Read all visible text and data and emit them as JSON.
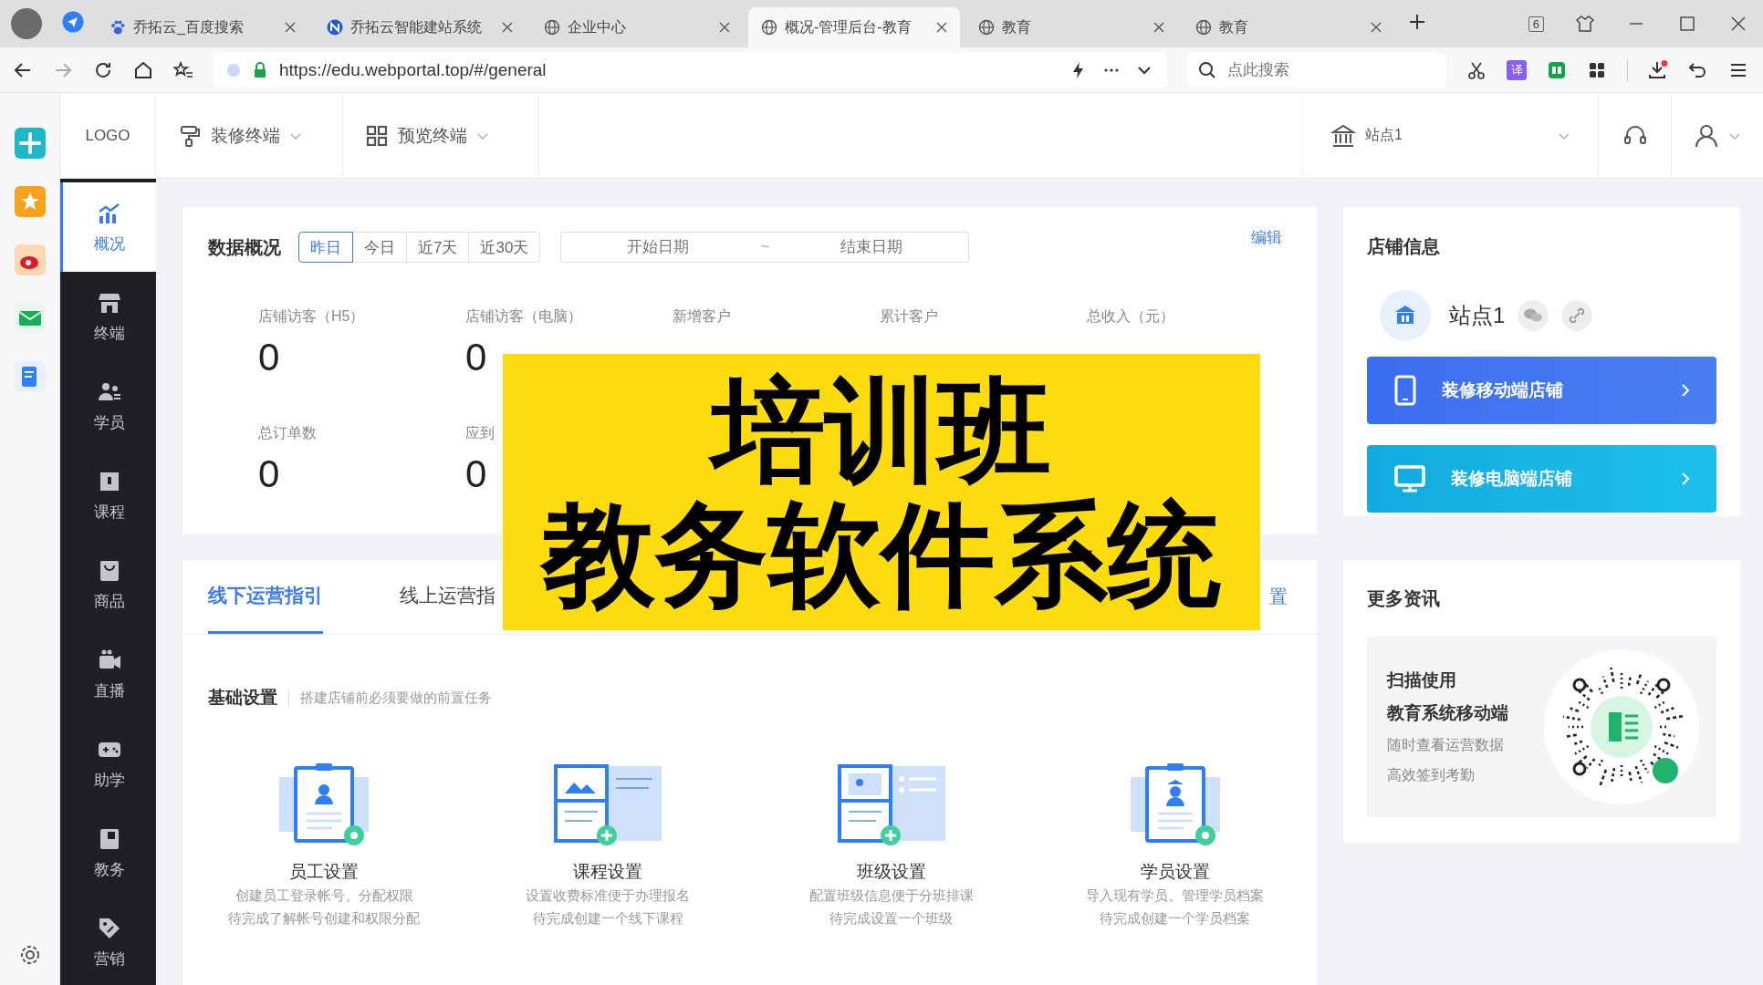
{
  "browser": {
    "tabs": [
      {
        "label": "乔拓云_百度搜索",
        "kind": "paw",
        "selected": false
      },
      {
        "label": "乔拓云智能建站系统",
        "kind": "circle",
        "selected": false
      },
      {
        "label": "企业中心",
        "kind": "globe",
        "selected": false
      },
      {
        "label": "概况-管理后台-教育",
        "kind": "globe",
        "selected": true
      },
      {
        "label": "教育",
        "kind": "globe",
        "selected": false
      },
      {
        "label": "教育",
        "kind": "globe",
        "selected": false
      }
    ],
    "tab_count": "6",
    "address": "https://edu.webportal.top/#/general",
    "search": {
      "placeholder": "点此搜索"
    },
    "translate_glyph": "译"
  },
  "app_header": {
    "logo": "LOGO",
    "menus": [
      {
        "label": "装修终端",
        "kind": "brush"
      },
      {
        "label": "预览终端",
        "kind": "grid"
      }
    ],
    "site": "站点1"
  },
  "sidebar": {
    "items": [
      {
        "label": "概况",
        "kind": "chart",
        "selected": true
      },
      {
        "label": "终端",
        "kind": "store",
        "selected": false
      },
      {
        "label": "学员",
        "kind": "people",
        "selected": false
      },
      {
        "label": "课程",
        "kind": "book",
        "selected": false
      },
      {
        "label": "商品",
        "kind": "bag",
        "selected": false
      },
      {
        "label": "直播",
        "kind": "camera",
        "selected": false
      },
      {
        "label": "助学",
        "kind": "gamepad",
        "selected": false
      },
      {
        "label": "教务",
        "kind": "folder",
        "selected": false
      },
      {
        "label": "营销",
        "kind": "tag",
        "selected": false
      }
    ]
  },
  "data_overview": {
    "title": "数据概况",
    "ranges": [
      {
        "label": "昨日",
        "selected": true
      },
      {
        "label": "今日",
        "selected": false
      },
      {
        "label": "近7天",
        "selected": false
      },
      {
        "label": "近30天",
        "selected": false
      }
    ],
    "date_range": {
      "start_placeholder": "开始日期",
      "separator": "~",
      "end_placeholder": "结束日期"
    },
    "edit": "编辑",
    "stats": [
      {
        "label": "店铺访客（H5）",
        "value": "0"
      },
      {
        "label": "店铺访客（电脑）",
        "value": "0"
      },
      {
        "label": "新增客户"
      },
      {
        "label": "累计客户"
      },
      {
        "label": "总收入（元）"
      },
      {
        "label": "总订单数",
        "value": "0"
      },
      {
        "label": "应到",
        "value": "0"
      }
    ]
  },
  "guide": {
    "tabs": [
      {
        "label": "线下运营指引",
        "selected": true
      },
      {
        "label": "线上运营指",
        "selected": false
      }
    ],
    "link": "置",
    "section": {
      "title": "基础设置",
      "subtitle": "搭建店铺前必须要做的前置任务"
    },
    "tasks": [
      {
        "kind": "staff",
        "title": "员工设置",
        "lines": [
          "创建员工登录帐号、分配权限",
          "待完成了解帐号创建和权限分配"
        ]
      },
      {
        "kind": "course",
        "title": "课程设置",
        "lines": [
          "设置收费标准便于办理报名",
          "待完成创建一个线下课程"
        ]
      },
      {
        "kind": "class",
        "title": "班级设置",
        "lines": [
          "配置班级信息便于分班排课",
          "待完成设置一个班级"
        ]
      },
      {
        "kind": "student",
        "title": "学员设置",
        "lines": [
          "导入现有学员、管理学员档案",
          "待完成创建一个学员档案"
        ]
      }
    ]
  },
  "shop_info": {
    "title": "店铺信息",
    "site": "站点1",
    "buttons": [
      {
        "kind": "mobile",
        "label": "装修移动端店铺"
      },
      {
        "kind": "desktop",
        "label": "装修电脑端店铺"
      }
    ]
  },
  "more_info": {
    "title": "更多资讯",
    "heading": [
      "扫描使用",
      "教育系统移动端"
    ],
    "lines": [
      "随时查看运营数据",
      "高效签到考勤"
    ]
  },
  "overlay": {
    "lines": [
      "培训班",
      "教务软件系统"
    ]
  }
}
